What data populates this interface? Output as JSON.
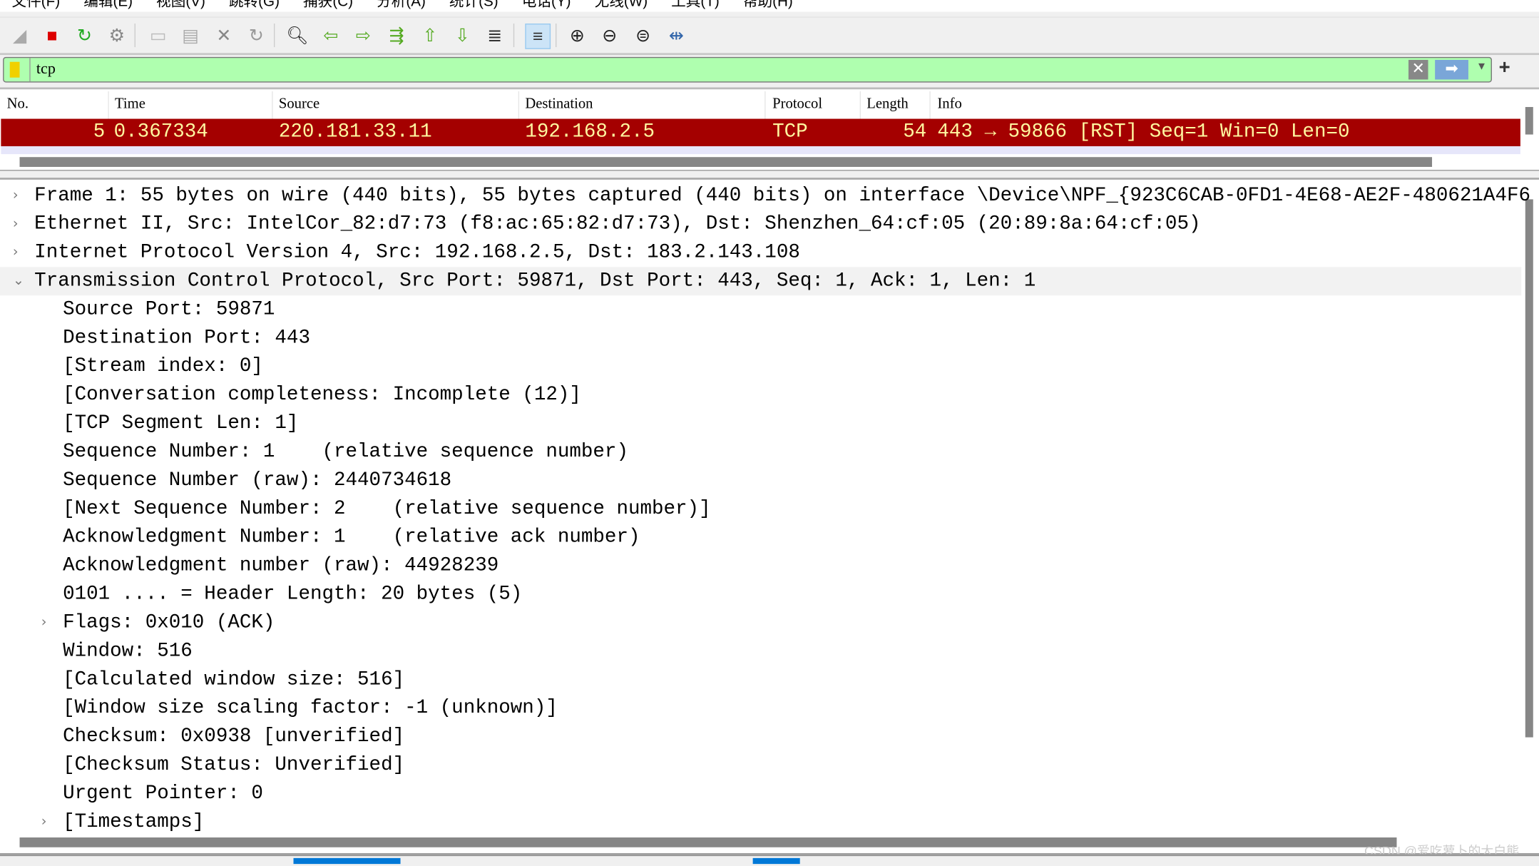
{
  "menu": [
    "文件(F)",
    "编辑(E)",
    "视图(V)",
    "跳转(G)",
    "捕获(C)",
    "分析(A)",
    "统计(S)",
    "电话(Y)",
    "无线(W)",
    "工具(T)",
    "帮助(H)"
  ],
  "toolbar": {
    "icons": [
      "shark-fin-start-icon",
      "stop-capture-icon",
      "restart-capture-icon",
      "capture-options-icon",
      "open-file-icon",
      "save-file-icon",
      "close-file-icon",
      "reload-file-icon",
      "find-packet-icon",
      "go-back-icon",
      "go-forward-icon",
      "go-to-packet-icon",
      "first-packet-icon",
      "last-packet-icon",
      "autoscroll-icon",
      "colorize-icon",
      "zoom-in-icon",
      "zoom-out-icon",
      "normal-size-icon",
      "resize-columns-icon"
    ],
    "colorize_active": true
  },
  "filter": {
    "value": "tcp",
    "color": "#afffaf"
  },
  "packet_list": {
    "columns": [
      "No.",
      "Time",
      "Source",
      "Destination",
      "Protocol",
      "Length",
      "Info"
    ],
    "rows": [
      {
        "no": "5",
        "time": "0.367334",
        "source": "220.181.33.11",
        "destination": "192.168.2.5",
        "protocol": "TCP",
        "length": "54",
        "info": "443 → 59866 [RST] Seq=1 Win=0 Len=0",
        "bg": "#a40000",
        "fg": "#fff7a0"
      }
    ]
  },
  "details": [
    {
      "text": "Frame 1: 55 bytes on wire (440 bits), 55 bytes captured (440 bits) on interface \\Device\\NPF_{923C6CAB-0FD1-4E68-AE2F-480621A4F6",
      "level": 0,
      "expander": "collapsed"
    },
    {
      "text": "Ethernet II, Src: IntelCor_82:d7:73 (f8:ac:65:82:d7:73), Dst: Shenzhen_64:cf:05 (20:89:8a:64:cf:05)",
      "level": 0,
      "expander": "collapsed"
    },
    {
      "text": "Internet Protocol Version 4, Src: 192.168.2.5, Dst: 183.2.143.108",
      "level": 0,
      "expander": "collapsed"
    },
    {
      "text": "Transmission Control Protocol, Src Port: 59871, Dst Port: 443, Seq: 1, Ack: 1, Len: 1",
      "level": 0,
      "expander": "expanded",
      "selected": true
    },
    {
      "text": "Source Port: 59871",
      "level": 1
    },
    {
      "text": "Destination Port: 443",
      "level": 1
    },
    {
      "text": "[Stream index: 0]",
      "level": 1
    },
    {
      "text": "[Conversation completeness: Incomplete (12)]",
      "level": 1
    },
    {
      "text": "[TCP Segment Len: 1]",
      "level": 1
    },
    {
      "text": "Sequence Number: 1    (relative sequence number)",
      "level": 1
    },
    {
      "text": "Sequence Number (raw): 2440734618",
      "level": 1
    },
    {
      "text": "[Next Sequence Number: 2    (relative sequence number)]",
      "level": 1
    },
    {
      "text": "Acknowledgment Number: 1    (relative ack number)",
      "level": 1
    },
    {
      "text": "Acknowledgment number (raw): 44928239",
      "level": 1
    },
    {
      "text": "0101 .... = Header Length: 20 bytes (5)",
      "level": 1
    },
    {
      "text": "Flags: 0x010 (ACK)",
      "level": 1,
      "expander": "collapsed"
    },
    {
      "text": "Window: 516",
      "level": 1
    },
    {
      "text": "[Calculated window size: 516]",
      "level": 1
    },
    {
      "text": "[Window size scaling factor: -1 (unknown)]",
      "level": 1
    },
    {
      "text": "Checksum: 0x0938 [unverified]",
      "level": 1
    },
    {
      "text": "[Checksum Status: Unverified]",
      "level": 1
    },
    {
      "text": "Urgent Pointer: 0",
      "level": 1
    },
    {
      "text": "[Timestamps]",
      "level": 1,
      "expander": "collapsed"
    }
  ],
  "watermark": "CSDN @爱吃萝卜的大白熊"
}
